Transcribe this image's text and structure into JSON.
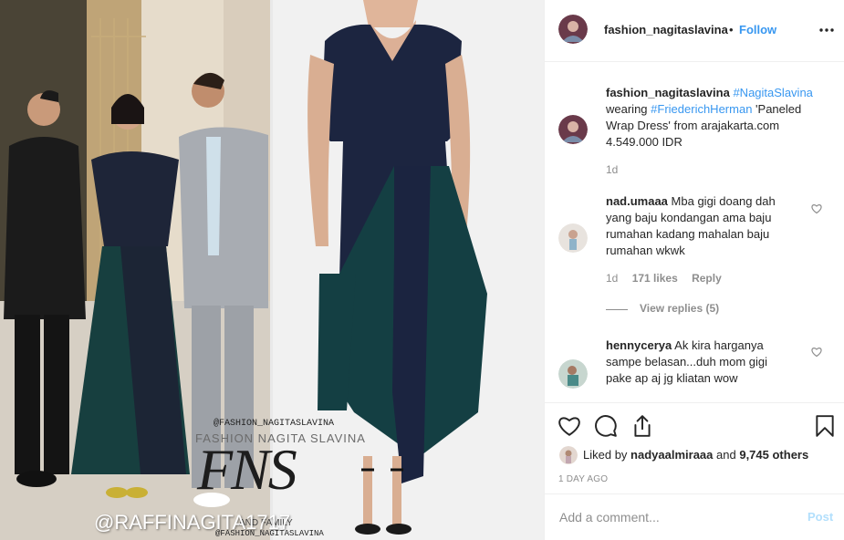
{
  "media": {
    "watermark_handle_top": "@FASHION_NAGITASLAVINA",
    "watermark_name": "FASHION NAGITA SLAVINA",
    "watermark_logo": "FNS",
    "watermark_family": "AND FAMILY",
    "watermark_handle_bottom": "@FASHION_NAGITASLAVINA",
    "overlay_handle": "@RAFFINAGITA1717"
  },
  "header": {
    "username": "fashion_nagitaslavina",
    "separator": "•",
    "follow_label": "Follow",
    "more_icon": "more-horizontal-icon"
  },
  "caption": {
    "username": "fashion_nagitaslavina",
    "hashtag1": "#NagitaSlavina",
    "text1": "wearing",
    "hashtag2": "#FriederichHerman",
    "text2": "'Paneled Wrap Dress' from arajakarta.com 4.549.000 IDR",
    "time": "1d"
  },
  "comments": [
    {
      "username": "nad.umaaa",
      "text": "Mba gigi doang dah yang baju kondangan ama baju rumahan kadang mahalan baju rumahan wkwk",
      "time": "1d",
      "likes": "171 likes",
      "reply_label": "Reply",
      "view_replies": "View replies (5)"
    },
    {
      "username": "hennycerya",
      "text": "Ak kira harganya sampe belasan...duh mom gigi pake ap aj jg kliatan wow"
    }
  ],
  "actions": {
    "liked_by_prefix": "Liked by",
    "liked_by_user": "nadyaalmiraaa",
    "liked_by_and": "and",
    "liked_by_others": "9,745 others",
    "date": "1 DAY AGO"
  },
  "comment_box": {
    "placeholder": "Add a comment...",
    "post_label": "Post"
  },
  "colors": {
    "link_blue": "#3897f0",
    "text": "#262626",
    "muted": "#8e8e8e",
    "border": "#efefef"
  }
}
